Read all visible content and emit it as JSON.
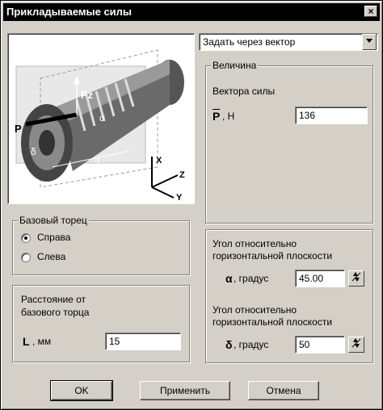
{
  "window": {
    "title": "Прикладываемые силы",
    "close_glyph": "×"
  },
  "mode_select": {
    "value": "Задать через вектор"
  },
  "magnitude_group": {
    "legend": "Величина",
    "vector_label": "Вектора силы",
    "p_symbol": "P",
    "p_unit": ", Н",
    "p_value": "136"
  },
  "base_face_group": {
    "legend": "Базовый торец",
    "options": [
      {
        "label": "Справа",
        "checked": true
      },
      {
        "label": "Слева",
        "checked": false
      }
    ]
  },
  "distance_group": {
    "label_line1": "Расстояние от",
    "label_line2": "базового торца",
    "l_symbol": "L",
    "l_unit": ", мм",
    "l_value": "15"
  },
  "angles_group": {
    "alpha_title_line1": "Угол относительно",
    "alpha_title_line2": "горизонтальной плоскости",
    "alpha_symbol": "α",
    "alpha_unit": ", градус",
    "alpha_value": "45.00",
    "delta_title_line1": "Угол относительно",
    "delta_title_line2": "горизонтальной плоскости",
    "delta_symbol": "δ",
    "delta_unit": ", градус",
    "delta_value": "50"
  },
  "diagram": {
    "labels": {
      "p": "P",
      "pz": "Pz",
      "alpha": "α",
      "delta": "δ",
      "l": "L",
      "x": "X",
      "y": "Y",
      "z": "Z"
    }
  },
  "buttons": {
    "ok": "OK",
    "apply": "Применить",
    "cancel": "Отмена"
  }
}
